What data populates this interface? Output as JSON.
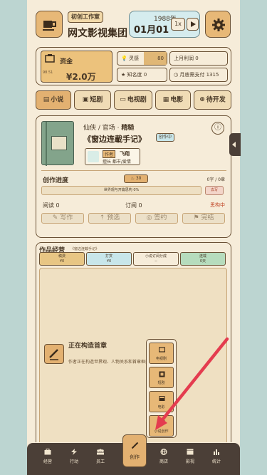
{
  "header": {
    "studio_tag": "初创工作室",
    "company_name": "网文影视集团",
    "year": "1988年",
    "date": "01月01",
    "speed": "1x"
  },
  "stats": {
    "fund_label": "资金",
    "fund_sub": "98.51",
    "fund_value": "¥2.0万",
    "inspiration_label": "灵感",
    "inspiration_value": "80",
    "fame_label": "知名度",
    "fame_value": "0",
    "last_month_profit_label": "上月利润",
    "last_month_profit_value": "0",
    "month_end_payment_label": "月底需支付",
    "month_end_payment_value": "1315"
  },
  "tabs": [
    {
      "label": "小说",
      "icon": "book-icon"
    },
    {
      "label": "短剧",
      "icon": "clapper-icon"
    },
    {
      "label": "电视剧",
      "icon": "tv-icon"
    },
    {
      "label": "电影",
      "icon": "film-icon"
    },
    {
      "label": "待开发",
      "icon": "gamepad-icon"
    }
  ],
  "novel": {
    "genre": "仙侠 / 官场 · ",
    "quality": "精糙",
    "title": "《窗边连載手记》",
    "status_badge": "创作中",
    "author_badge": "作者",
    "author_name": "飞翔",
    "author_genres": "擅长 都市/爱情"
  },
  "progress": {
    "title": "创作进度",
    "heat": "30",
    "words": "0字 / 0章",
    "bar_text": "世界观与开篇思构 0%",
    "bar_fraction": 0,
    "bar_button": "去写",
    "reads_label": "阅读",
    "reads_value": "0",
    "subs_label": "订阅",
    "subs_value": "0",
    "state": "思构中",
    "actions": [
      "写作",
      "预选",
      "签约",
      "完结"
    ]
  },
  "ops": {
    "title": "作品经营",
    "subtitle": "《窗边连載手记》",
    "boxes": [
      {
        "label": "稿费",
        "value": "¥0"
      },
      {
        "label": "打赏",
        "value": "¥0"
      },
      {
        "label": "小说订阅分成",
        "value": "--"
      },
      {
        "label": "连载",
        "value": "0天"
      }
    ],
    "build_title": "正在构造首章",
    "build_desc": "作者正在构造世界观、人物关系和首章框架。"
  },
  "popup_menu": [
    {
      "label": "电视剧",
      "icon": "tv-icon"
    },
    {
      "label": "短剧",
      "icon": "clapper-icon"
    },
    {
      "label": "电影",
      "icon": "film-icon"
    },
    {
      "label": "小说创作",
      "icon": "pen-icon"
    }
  ],
  "nav": [
    {
      "label": "经营",
      "icon": "briefcase-icon"
    },
    {
      "label": "行动",
      "icon": "lightning-icon"
    },
    {
      "label": "员工",
      "icon": "people-icon"
    },
    {
      "label": "创作",
      "icon": "pen-icon"
    },
    {
      "label": "商店",
      "icon": "globe-icon"
    },
    {
      "label": "影视",
      "icon": "clapper-icon"
    },
    {
      "label": "统计",
      "icon": "bar-chart-icon"
    }
  ]
}
